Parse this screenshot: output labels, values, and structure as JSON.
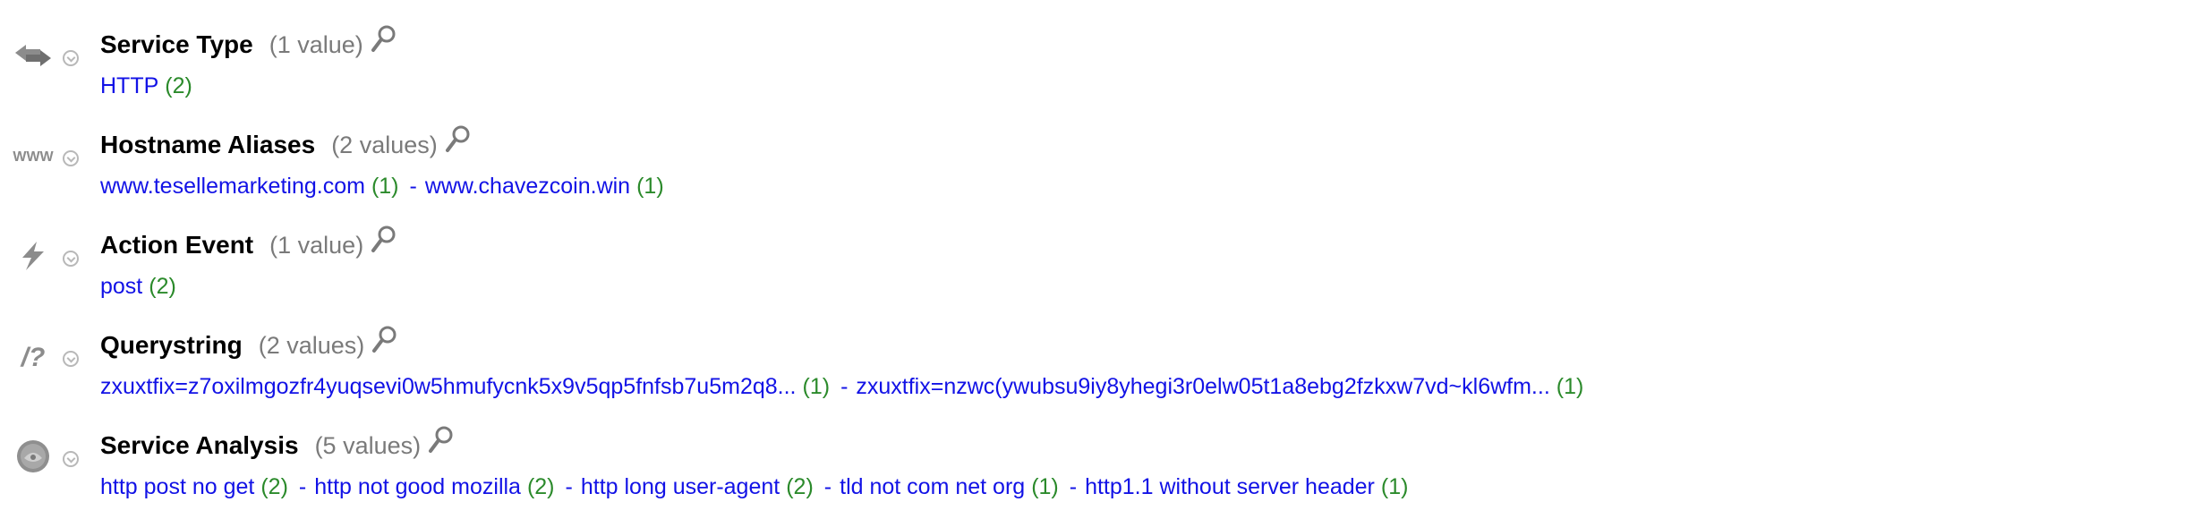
{
  "facets": [
    {
      "title": "Service Type",
      "count_label": "(1 value)",
      "icon": "arrows-exchange-icon",
      "values": [
        {
          "label": "HTTP",
          "count": "(2)"
        }
      ]
    },
    {
      "title": "Hostname Aliases",
      "count_label": "(2 values)",
      "icon": "www-icon",
      "values": [
        {
          "label": "www.tesellemarketing.com",
          "count": "(1)"
        },
        {
          "label": "www.chavezcoin.win",
          "count": "(1)"
        }
      ]
    },
    {
      "title": "Action Event",
      "count_label": "(1 value)",
      "icon": "lightning-icon",
      "values": [
        {
          "label": "post",
          "count": "(2)"
        }
      ]
    },
    {
      "title": "Querystring",
      "count_label": "(2 values)",
      "icon": "querystring-icon",
      "values": [
        {
          "label": "zxuxtfix=z7oxilmgozfr4yuqsevi0w5hmufycnk5x9v5qp5fnfsb7u5m2q8...",
          "count": "(1)"
        },
        {
          "label": "zxuxtfix=nzwc(ywubsu9iy8yhegi3r0elw05t1a8ebg2fzkxw7vd~kl6wfm...",
          "count": "(1)"
        }
      ]
    },
    {
      "title": "Service Analysis",
      "count_label": "(5 values)",
      "icon": "analysis-badge-icon",
      "values": [
        {
          "label": "http post no get",
          "count": "(2)"
        },
        {
          "label": "http not good mozilla",
          "count": "(2)"
        },
        {
          "label": "http long user-agent",
          "count": "(2)"
        },
        {
          "label": "tld not com net org",
          "count": "(1)"
        },
        {
          "label": "http1.1 without server header",
          "count": "(1)"
        }
      ]
    }
  ],
  "separator": "-",
  "colors": {
    "link": "#1212e6",
    "count": "#2b8a2b",
    "muted": "#7a7a7a",
    "icon": "#8c8c8c"
  }
}
